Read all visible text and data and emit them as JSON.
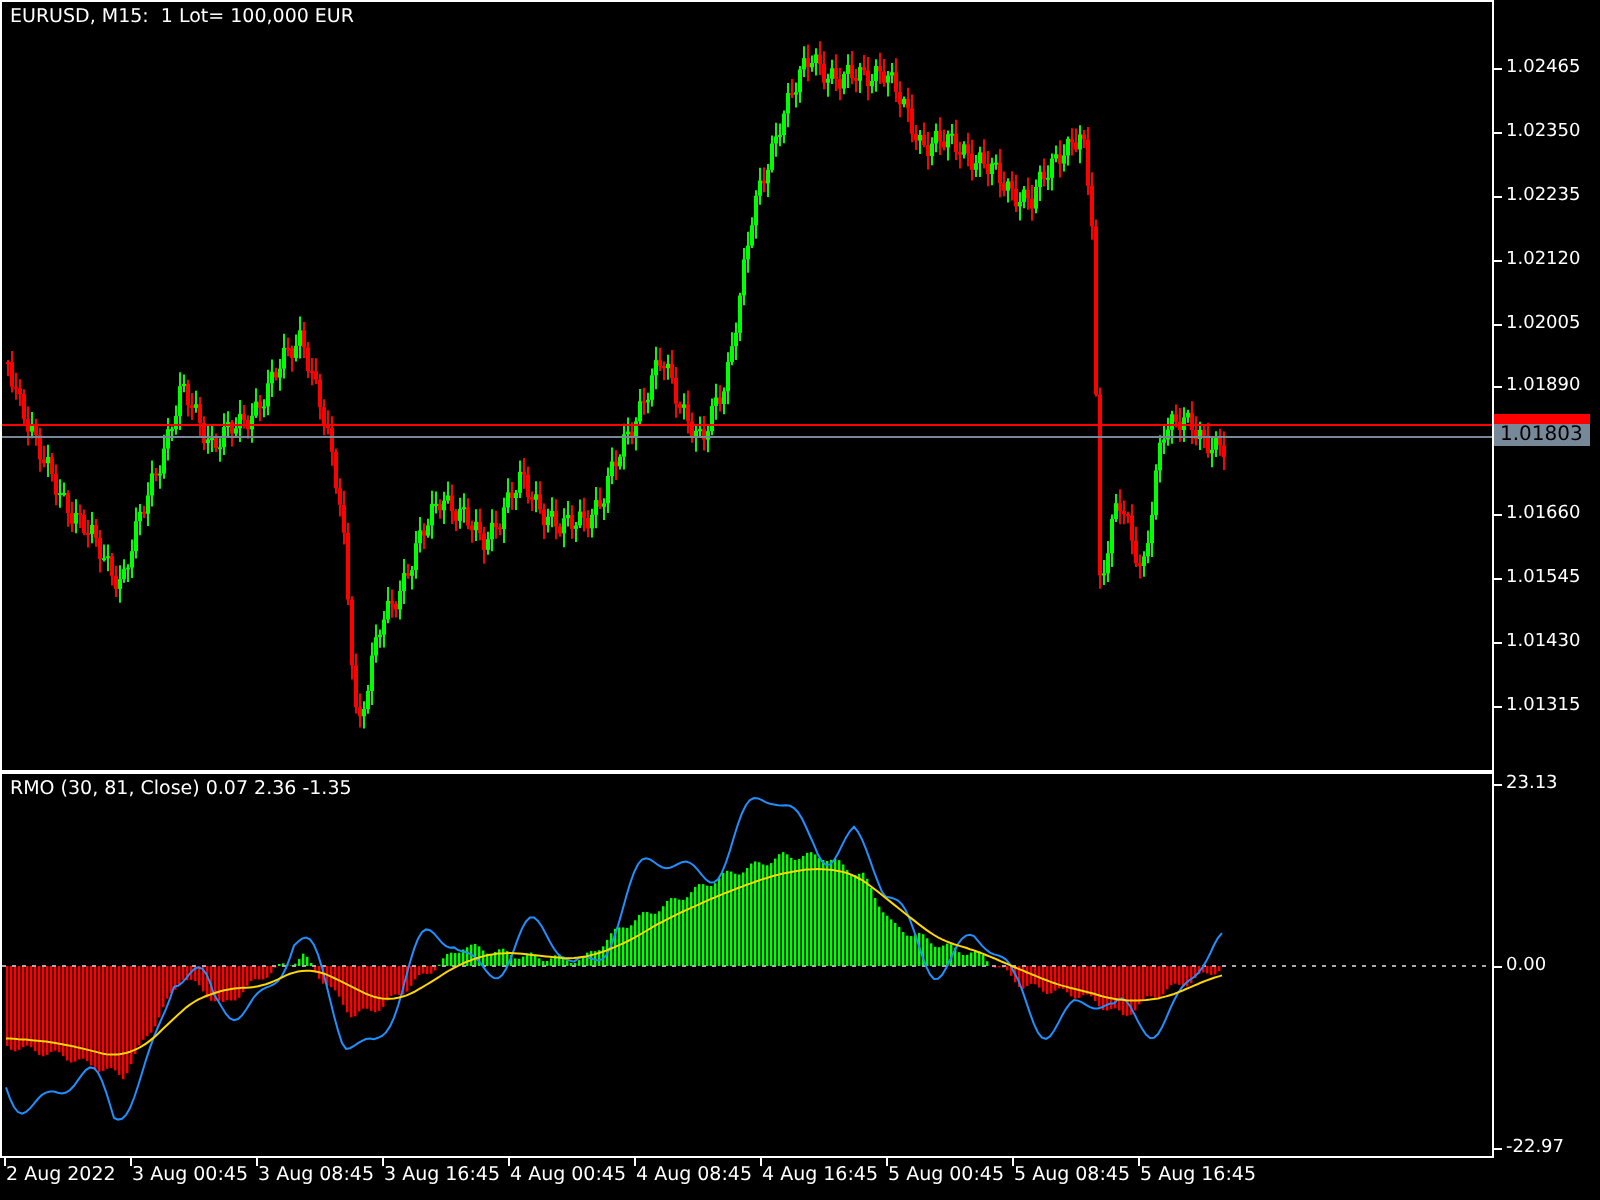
{
  "chart": {
    "title": "EURUSD, M15:  1 Lot= 100,000 EUR",
    "price_axis": [
      "1.02465",
      "1.02350",
      "1.02235",
      "1.02120",
      "1.02005",
      "1.01890",
      "1.01660",
      "1.01545",
      "1.01430",
      "1.01315"
    ],
    "bid_label": "1.01803"
  },
  "indicator": {
    "title": "RMO (30, 81, Close) 0.07 2.36 -1.35",
    "axis": [
      "23.13",
      "0.00",
      "-22.97"
    ]
  },
  "time_axis": [
    "2 Aug 2022",
    "3 Aug 00:45",
    "3 Aug 08:45",
    "3 Aug 16:45",
    "4 Aug 00:45",
    "4 Aug 08:45",
    "4 Aug 16:45",
    "5 Aug 00:45",
    "5 Aug 08:45",
    "5 Aug 16:45"
  ]
}
